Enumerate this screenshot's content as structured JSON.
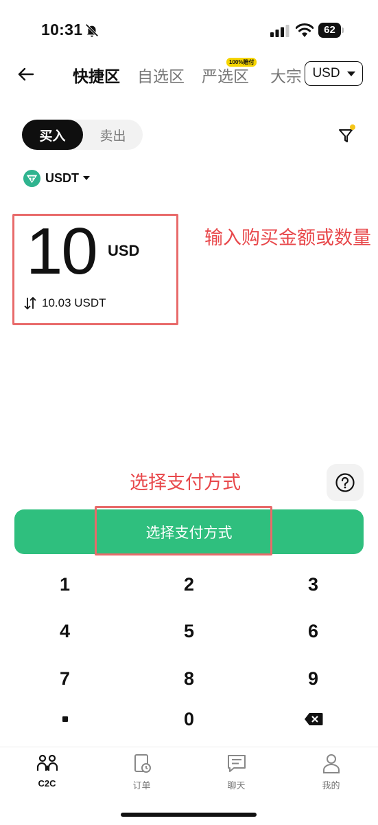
{
  "status_bar": {
    "time": "10:31",
    "battery": "62",
    "battery_fill_percent": 62
  },
  "header": {
    "tabs": [
      {
        "label": "快捷区",
        "active": true
      },
      {
        "label": "自选区",
        "active": false
      },
      {
        "label": "严选区",
        "active": false,
        "badge": "100%赔付"
      },
      {
        "label": "大宗",
        "active": false
      }
    ],
    "currency": "USD"
  },
  "trade": {
    "buy_label": "买入",
    "sell_label": "卖出",
    "selected": "buy"
  },
  "coin": {
    "symbol": "USDT"
  },
  "amount": {
    "value": "10",
    "unit": "USD",
    "converted": "10.03 USDT"
  },
  "annotations": {
    "input_hint": "输入购买金额或数量",
    "pay_hint": "选择支付方式"
  },
  "pay_button": {
    "label": "选择支付方式"
  },
  "keypad": {
    "keys": [
      "1",
      "2",
      "3",
      "4",
      "5",
      "6",
      "7",
      "8",
      "9",
      ".",
      "0",
      "⌫"
    ]
  },
  "bottom_nav": [
    {
      "label": "C2C",
      "icon": "c2c-icon",
      "active": true
    },
    {
      "label": "订单",
      "icon": "orders-icon",
      "active": false
    },
    {
      "label": "聊天",
      "icon": "chat-icon",
      "active": false
    },
    {
      "label": "我的",
      "icon": "profile-icon",
      "active": false
    }
  ],
  "colors": {
    "accent_green": "#2fbf7e",
    "annotation_red": "#e8484b",
    "filter_dot": "#f5c518"
  }
}
